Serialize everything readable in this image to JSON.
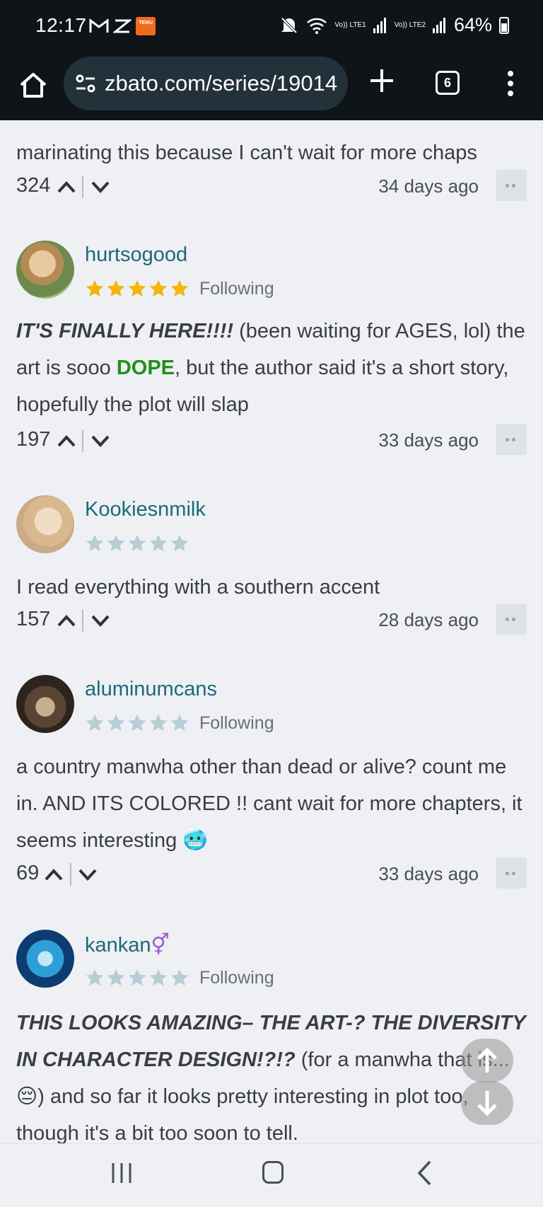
{
  "status_bar": {
    "time": "12:17",
    "temu_label": "TEMU",
    "signal1": "Vo)) LTE1",
    "signal2": "Vo)) LTE2",
    "battery": "64%"
  },
  "browser": {
    "url": "zbato.com/series/19014",
    "tab_count": "6"
  },
  "comments": [
    {
      "partial_text": "marinating this because I can't wait for more chaps",
      "votes": "324",
      "time": "34 days ago"
    },
    {
      "username": "hurtsogood",
      "stars_filled": 5,
      "following": "Following",
      "text_bold": "IT'S FINALLY HERE!!!!",
      "text_1": " (been waiting for AGES, lol) the art is sooo ",
      "text_green": "DOPE",
      "text_2": ", but the author said it's a short story, hopefully the plot will slap",
      "votes": "197",
      "time": "33 days ago"
    },
    {
      "username": "Kookiesnmilk",
      "stars_filled": 0,
      "text": "I read everything with a southern accent",
      "votes": "157",
      "time": "28 days ago"
    },
    {
      "username": "aluminumcans",
      "stars_filled": 0,
      "following": "Following",
      "text": "a country manwha other than dead or alive? count me in. AND ITS COLORED !! cant wait for more chapters, it seems interesting",
      "emoji": "🥶",
      "votes": "69",
      "time": "33 days ago"
    },
    {
      "username": "kankan",
      "gender_symbol": "⚥",
      "stars_filled": 0,
      "following": "Following",
      "text_bold": "THIS LOOKS AMAZING– THE ART-? THE DIVERSITY IN CHARACTER DESIGN!?!?",
      "text_1": " (for a manwha that is...",
      "emoji": "😔",
      "text_2": ") and so far it looks pretty interesting in plot too, though it's a bit too soon to tell."
    }
  ],
  "colors": {
    "username": "#1c6a77",
    "star_gold": "#f2b70a",
    "star_empty": "#b8ccd6",
    "dope_green": "#1e8f1e"
  }
}
